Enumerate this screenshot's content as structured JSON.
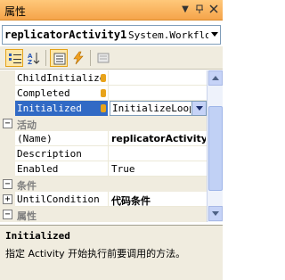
{
  "window": {
    "title": "属性"
  },
  "titlebar_icons": [
    "pin-dropdown-icon",
    "pin-icon",
    "close-icon"
  ],
  "object_selector": {
    "name": "replicatorActivity1",
    "type": "System.Workflow"
  },
  "toolbar": {
    "buttons": [
      "categorized",
      "alphabetical",
      "properties",
      "events",
      "property-pages"
    ],
    "pressed": [
      "categorized",
      "properties"
    ]
  },
  "rows": [
    {
      "kind": "prop",
      "name": "ChildInitialized",
      "value": "",
      "event": true
    },
    {
      "kind": "prop",
      "name": "Completed",
      "value": "",
      "event": true
    },
    {
      "kind": "prop",
      "name": "Initialized",
      "value": "InitializeLoop",
      "event": true,
      "selected": true
    },
    {
      "kind": "category",
      "label": "活动",
      "expanded": true
    },
    {
      "kind": "prop",
      "name": "(Name)",
      "value": "replicatorActivity1",
      "bold": true
    },
    {
      "kind": "prop",
      "name": "Description",
      "value": ""
    },
    {
      "kind": "prop",
      "name": "Enabled",
      "value": "True"
    },
    {
      "kind": "category",
      "label": "条件",
      "expanded": true
    },
    {
      "kind": "prop",
      "name": "UntilCondition",
      "value": "代码条件",
      "bold": true,
      "expandable": true
    },
    {
      "kind": "category",
      "label": "属性",
      "expanded": true
    }
  ],
  "help": {
    "title": "Initialized",
    "description": "指定 Activity 开始执行前要调用的方法。"
  },
  "colors": {
    "titlebar": "#f5a44a",
    "selection": "#316ac5",
    "category_bg": "#f0ecdf",
    "category_text": "#808080"
  }
}
